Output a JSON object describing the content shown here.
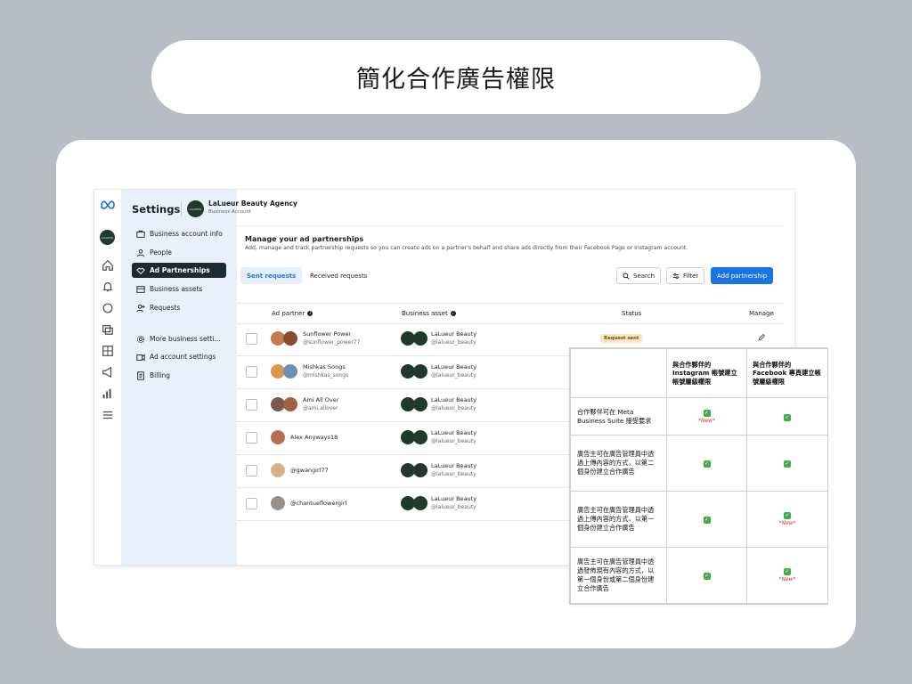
{
  "banner": {
    "title": "簡化合作廣告權限"
  },
  "app": {
    "rail_avatar": "LALUEUR",
    "header": {
      "settings": "Settings",
      "business_name": "LaLueur Beauty Agency",
      "business_sub": "Business Account",
      "avatar_text": "LALUEUR"
    },
    "nav": [
      {
        "label": "Business account info",
        "icon": "briefcase-icon"
      },
      {
        "label": "People",
        "icon": "people-icon"
      },
      {
        "label": "Ad Partnerships",
        "icon": "handshake-icon",
        "active": true
      },
      {
        "label": "Business assets",
        "icon": "assets-icon"
      },
      {
        "label": "Requests",
        "icon": "person-add-icon"
      },
      {
        "label": "More business setti...",
        "icon": "gear-icon"
      },
      {
        "label": "Ad account settings",
        "icon": "ad-account-icon"
      },
      {
        "label": "Billing",
        "icon": "billing-icon"
      }
    ],
    "main": {
      "title": "Manage your ad partnerships",
      "description": "Add, manage and track partnership requests so you can create ads on a partner's behalf and share ads directly from their Facebook Page or Instagram account.",
      "tabs": {
        "sent": "Sent requests",
        "received": "Received requests"
      },
      "buttons": {
        "search": "Search",
        "filter": "Filter",
        "add": "Add partnership"
      },
      "columns": {
        "partner": "Ad partner",
        "asset": "Business asset",
        "status": "Status",
        "manage": "Manage"
      },
      "rows": [
        {
          "name": "Sunflower Power",
          "handle": "@sunflower_power77",
          "asset": "LaLueur Beauty",
          "asset_handle": "@lalueur_beauty",
          "status": "Request sent"
        },
        {
          "name": "Mishkas Songs",
          "handle": "@mishkas_songs",
          "asset": "LaLueur Beauty",
          "asset_handle": "@lalueur_beauty",
          "status": ""
        },
        {
          "name": "Ami All Over",
          "handle": "@ami.allover",
          "asset": "LaLueur Beauty",
          "asset_handle": "@lalueur_beauty",
          "status": ""
        },
        {
          "name": "Alex Anyways18",
          "handle": "",
          "asset": "LaLueur Beauty",
          "asset_handle": "@lalueur_beauty",
          "status": ""
        },
        {
          "name": "@gwangirl77",
          "handle": "",
          "asset": "LaLueur Beauty",
          "asset_handle": "@lalueur_beauty",
          "status": ""
        },
        {
          "name": "@chantueflowergirl",
          "handle": "",
          "asset": "LaLueur Beauty",
          "asset_handle": "@lalueur_beauty",
          "status": ""
        }
      ]
    }
  },
  "comparison": {
    "col1": "與合作夥伴的 Instagram 帳號建立帳號層級權限",
    "col2": "與合作夥伴的 Facebook 專頁建立帳號層級權限",
    "new_label": "*New*",
    "rows": [
      {
        "label": "合作夥伴可在 Meta Business Suite 接受要求",
        "c1_new": true,
        "c2_new": false
      },
      {
        "label": "廣告主可在廣告管理員中透過上傳內容的方式，以第二個身份建立合作廣告",
        "c1_new": false,
        "c2_new": false
      },
      {
        "label": "廣告主可在廣告管理員中透過上傳內容的方式，以第一個身份建立合作廣告",
        "c1_new": false,
        "c2_new": true
      },
      {
        "label": "廣告主可在廣告管理員中透過發佈現有內容的方式，以第一個身份或第二個身份建立合作廣告",
        "c1_new": false,
        "c2_new": true
      }
    ]
  }
}
